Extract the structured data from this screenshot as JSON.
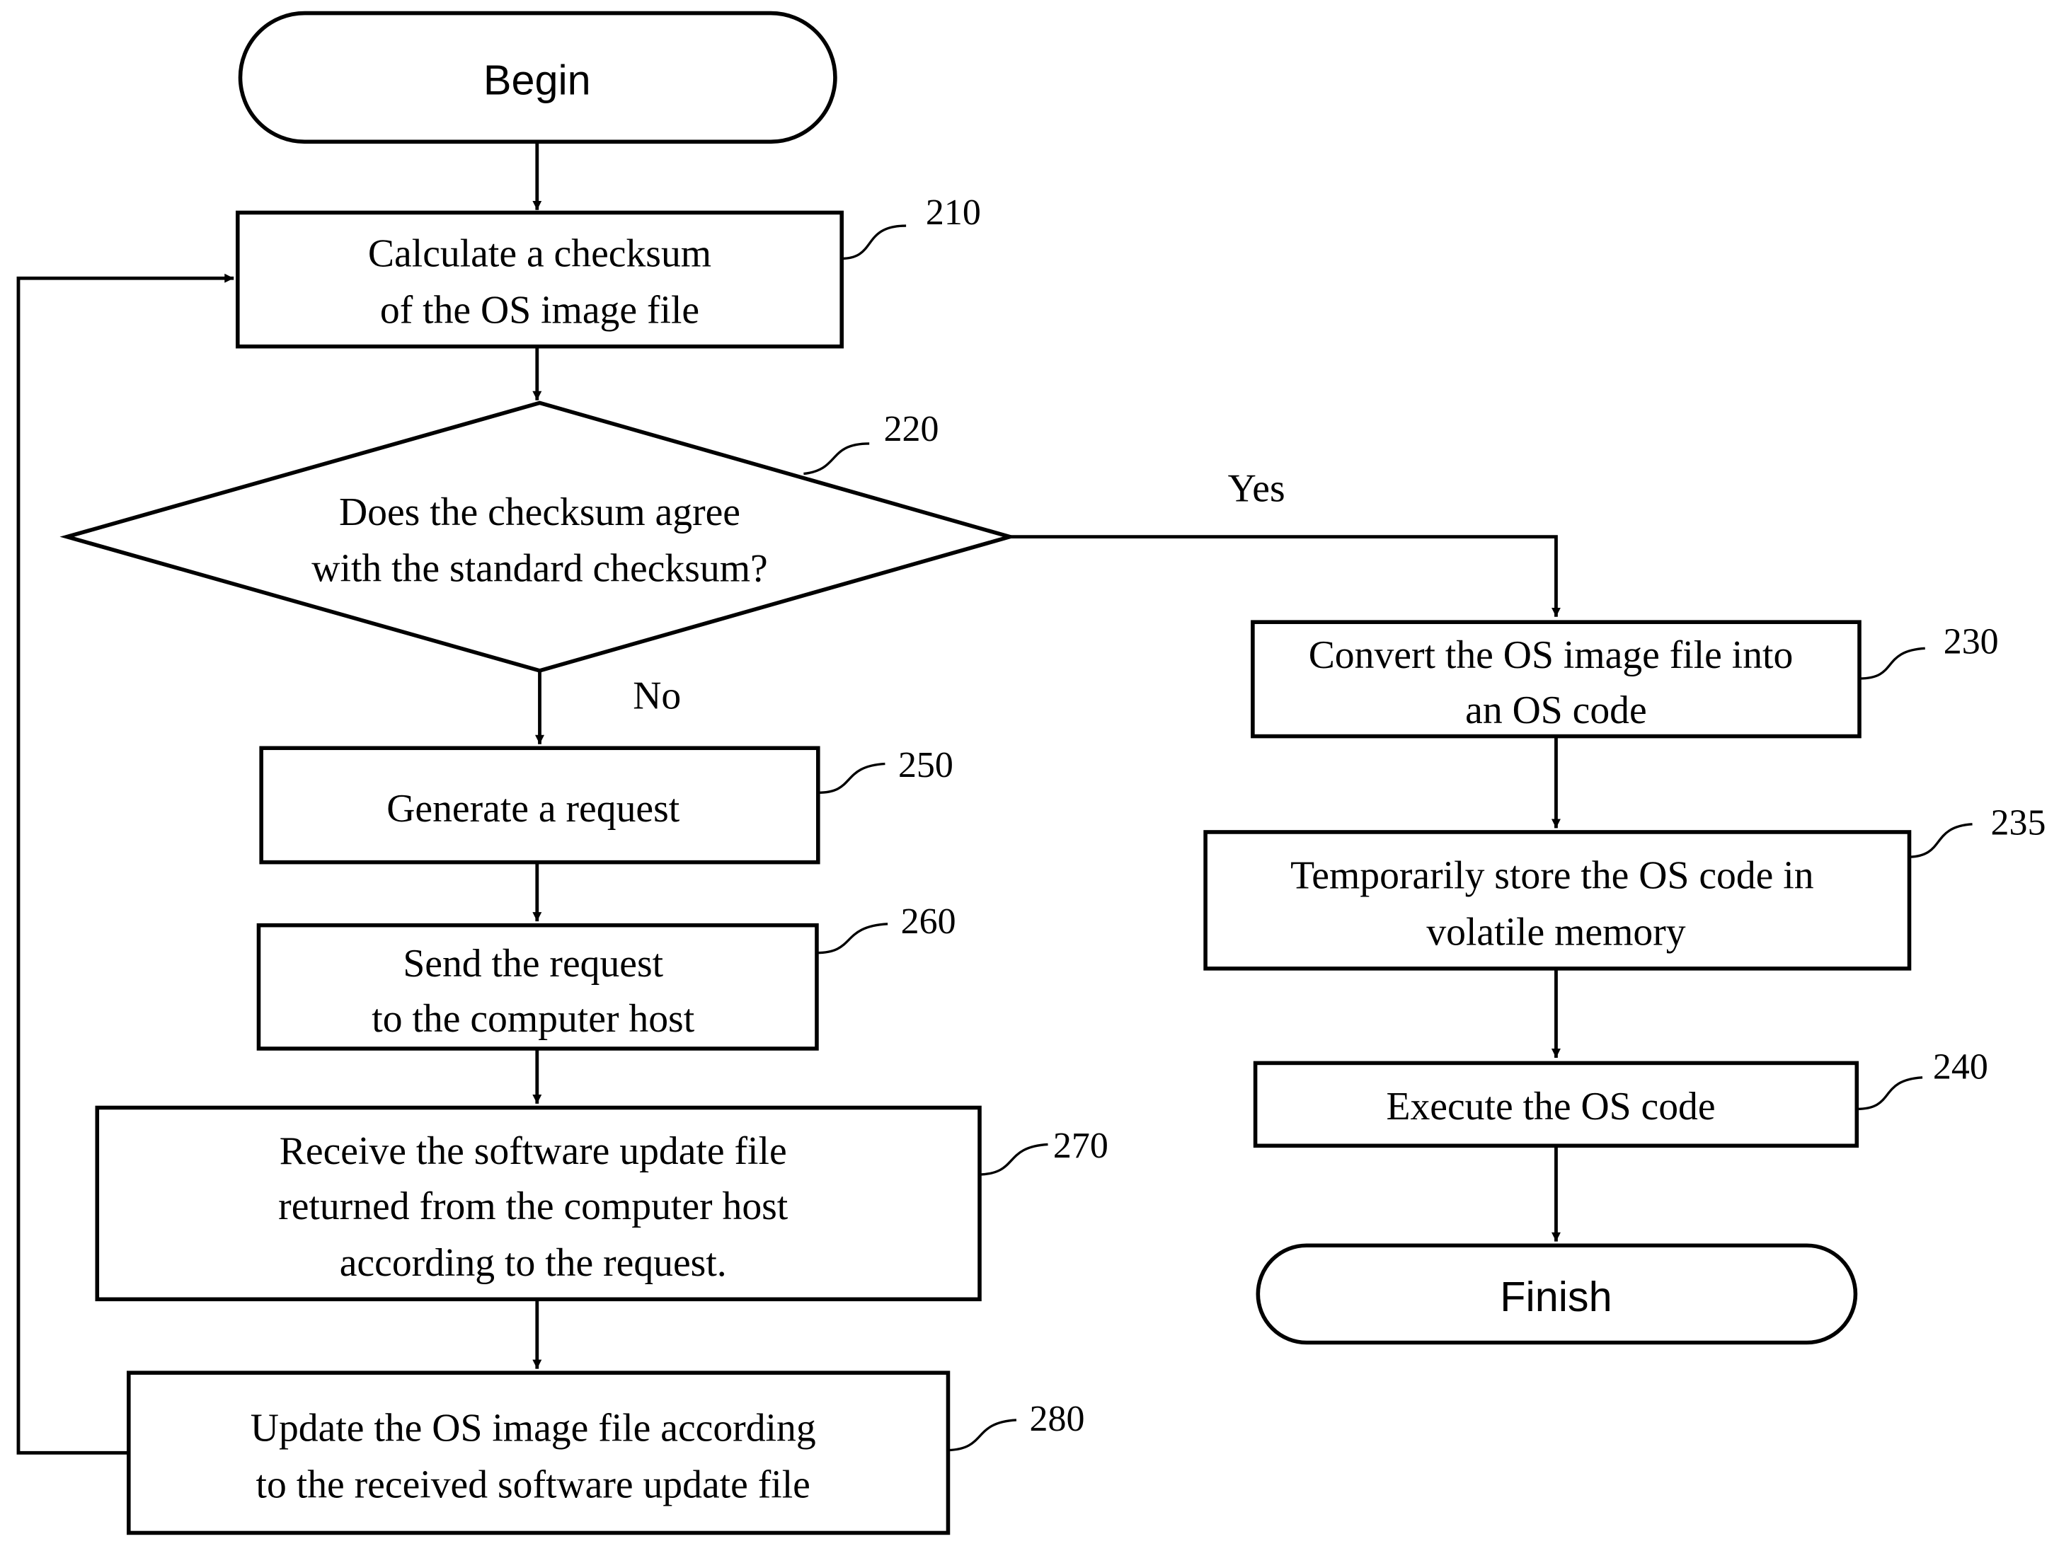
{
  "terminals": {
    "begin": "Begin",
    "finish": "Finish"
  },
  "steps": {
    "s210": {
      "ref": "210",
      "lines": [
        "Calculate a checksum",
        "of the OS image file"
      ]
    },
    "s220": {
      "ref": "220",
      "lines": [
        "Does the checksum agree",
        "with the standard checksum?"
      ]
    },
    "s230": {
      "ref": "230",
      "lines": [
        "Convert the OS image file into",
        "an OS code"
      ]
    },
    "s235": {
      "ref": "235",
      "lines": [
        "Temporarily store the OS code in",
        "volatile memory"
      ]
    },
    "s240": {
      "ref": "240",
      "lines": [
        "Execute the OS code"
      ]
    },
    "s250": {
      "ref": "250",
      "lines": [
        "Generate a request"
      ]
    },
    "s260": {
      "ref": "260",
      "lines": [
        "Send the request",
        "to the computer host"
      ]
    },
    "s270": {
      "ref": "270",
      "lines": [
        "Receive the software update file",
        "returned from the computer host",
        "according to the request."
      ]
    },
    "s280": {
      "ref": "280",
      "lines": [
        "Update the OS image file according",
        "to the received software update file"
      ]
    }
  },
  "branches": {
    "yes": "Yes",
    "no": "No"
  }
}
